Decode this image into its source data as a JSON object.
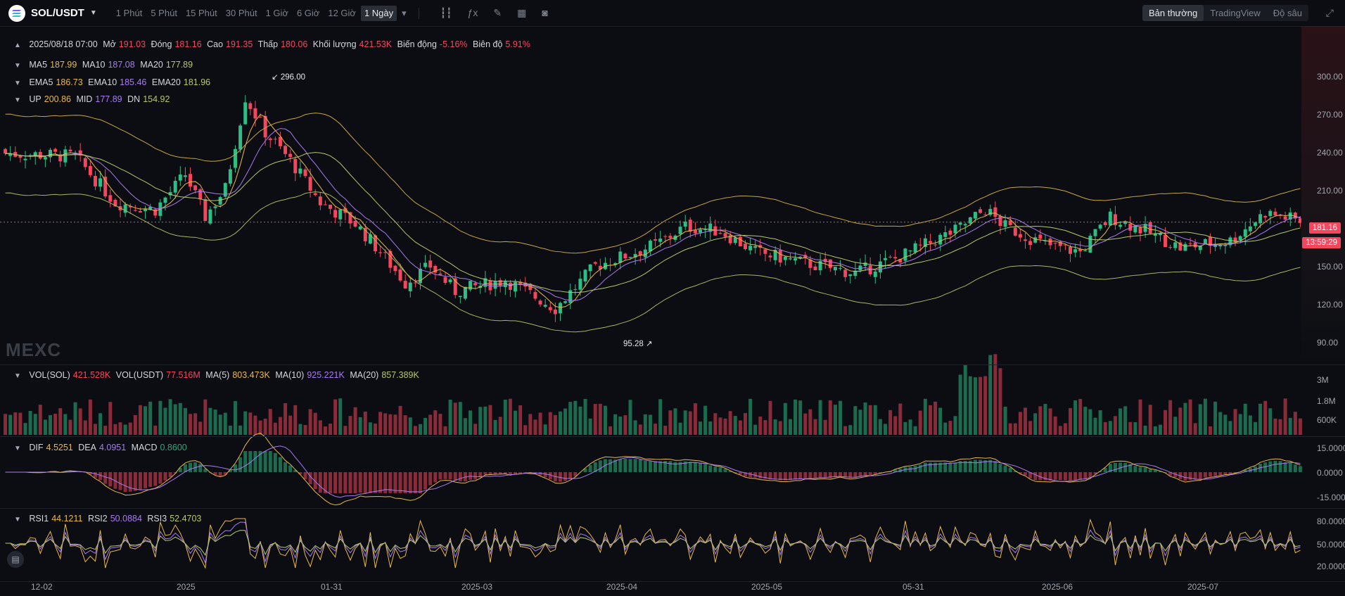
{
  "header": {
    "symbol": "SOL/USDT",
    "intervals": [
      "1 Phút",
      "5 Phút",
      "15 Phút",
      "30 Phút",
      "1 Giờ",
      "6 Giờ",
      "12 Giờ",
      "1 Ngày"
    ],
    "active_interval": "1 Ngày",
    "views": [
      "Bản thường",
      "TradingView",
      "Độ sâu"
    ],
    "active_view": "Bản thường"
  },
  "ohlc": {
    "date": "2025/08/18 07:00",
    "open_label": "Mở",
    "open": "191.03",
    "close_label": "Đóng",
    "close": "181.16",
    "high_label": "Cao",
    "high": "191.35",
    "low_label": "Thấp",
    "low": "180.06",
    "vol_label": "Khối lượng",
    "vol": "421.53K",
    "change_label": "Biến động",
    "change": "-5.16%",
    "amp_label": "Biên độ",
    "amp": "5.91%"
  },
  "ma": {
    "ma5_label": "MA5",
    "ma5": "187.99",
    "ma10_label": "MA10",
    "ma10": "187.08",
    "ma20_label": "MA20",
    "ma20": "177.89"
  },
  "ema": {
    "ema5_label": "EMA5",
    "ema5": "186.73",
    "ema10_label": "EMA10",
    "ema10": "185.46",
    "ema20_label": "EMA20",
    "ema20": "181.96"
  },
  "boll": {
    "up_label": "UP",
    "up": "200.86",
    "mid_label": "MID",
    "mid": "177.89",
    "dn_label": "DN",
    "dn": "154.92"
  },
  "volume": {
    "sol_label": "VOL(SOL)",
    "sol": "421.528K",
    "usdt_label": "VOL(USDT)",
    "usdt": "77.516M",
    "ma5_label": "MA(5)",
    "ma5": "803.473K",
    "ma10_label": "MA(10)",
    "ma10": "925.221K",
    "ma20_label": "MA(20)",
    "ma20": "857.389K"
  },
  "macd": {
    "dif_label": "DIF",
    "dif": "4.5251",
    "dea_label": "DEA",
    "dea": "4.0951",
    "macd_label": "MACD",
    "macd": "0.8600"
  },
  "rsi": {
    "rsi1_label": "RSI1",
    "rsi1": "44.1211",
    "rsi2_label": "RSI2",
    "rsi2": "50.0884",
    "rsi3_label": "RSI3",
    "rsi3": "52.4703"
  },
  "price_axis": [
    "300.00",
    "270.00",
    "240.00",
    "210.00",
    "180.00",
    "150.00",
    "120.00",
    "90.00"
  ],
  "volume_axis": [
    "3M",
    "1.8M",
    "600K"
  ],
  "macd_axis": [
    "15.0000",
    "0.0000",
    "-15.0000"
  ],
  "rsi_axis": [
    "80.0000",
    "50.0000",
    "20.0000"
  ],
  "last_price": "181.16",
  "countdown": "13:59:29",
  "chart_high": "296.00",
  "chart_low": "95.28",
  "watermark": "MEXC",
  "x_labels": [
    "12-02",
    "2025",
    "01-31",
    "2025-03",
    "2025-04",
    "2025-05",
    "05-31",
    "2025-06",
    "2025-07"
  ],
  "colors": {
    "up": "#2ebd85",
    "down": "#f6465d",
    "ma5": "#e9b949",
    "ma10": "#a97bf0",
    "ma20": "#b5c96a",
    "accent": "#f6465d"
  },
  "chart_data": {
    "type": "line",
    "title": "",
    "x": [
      "12-02",
      "2025",
      "01-31",
      "2025-03",
      "2025-04",
      "2025-05",
      "05-31",
      "2025-06",
      "2025-07"
    ],
    "series": [
      {
        "name": "MID",
        "values": [
          235,
          188,
          230,
          145,
          128,
          150,
          165,
          150,
          176
        ]
      }
    ],
    "ylim": [
      80,
      320
    ],
    "yticks": [
      300,
      270,
      240,
      210,
      180,
      150,
      120,
      90
    ],
    "grid": false,
    "notes_extremes": {
      "high": 296.0,
      "low": 95.28
    }
  }
}
